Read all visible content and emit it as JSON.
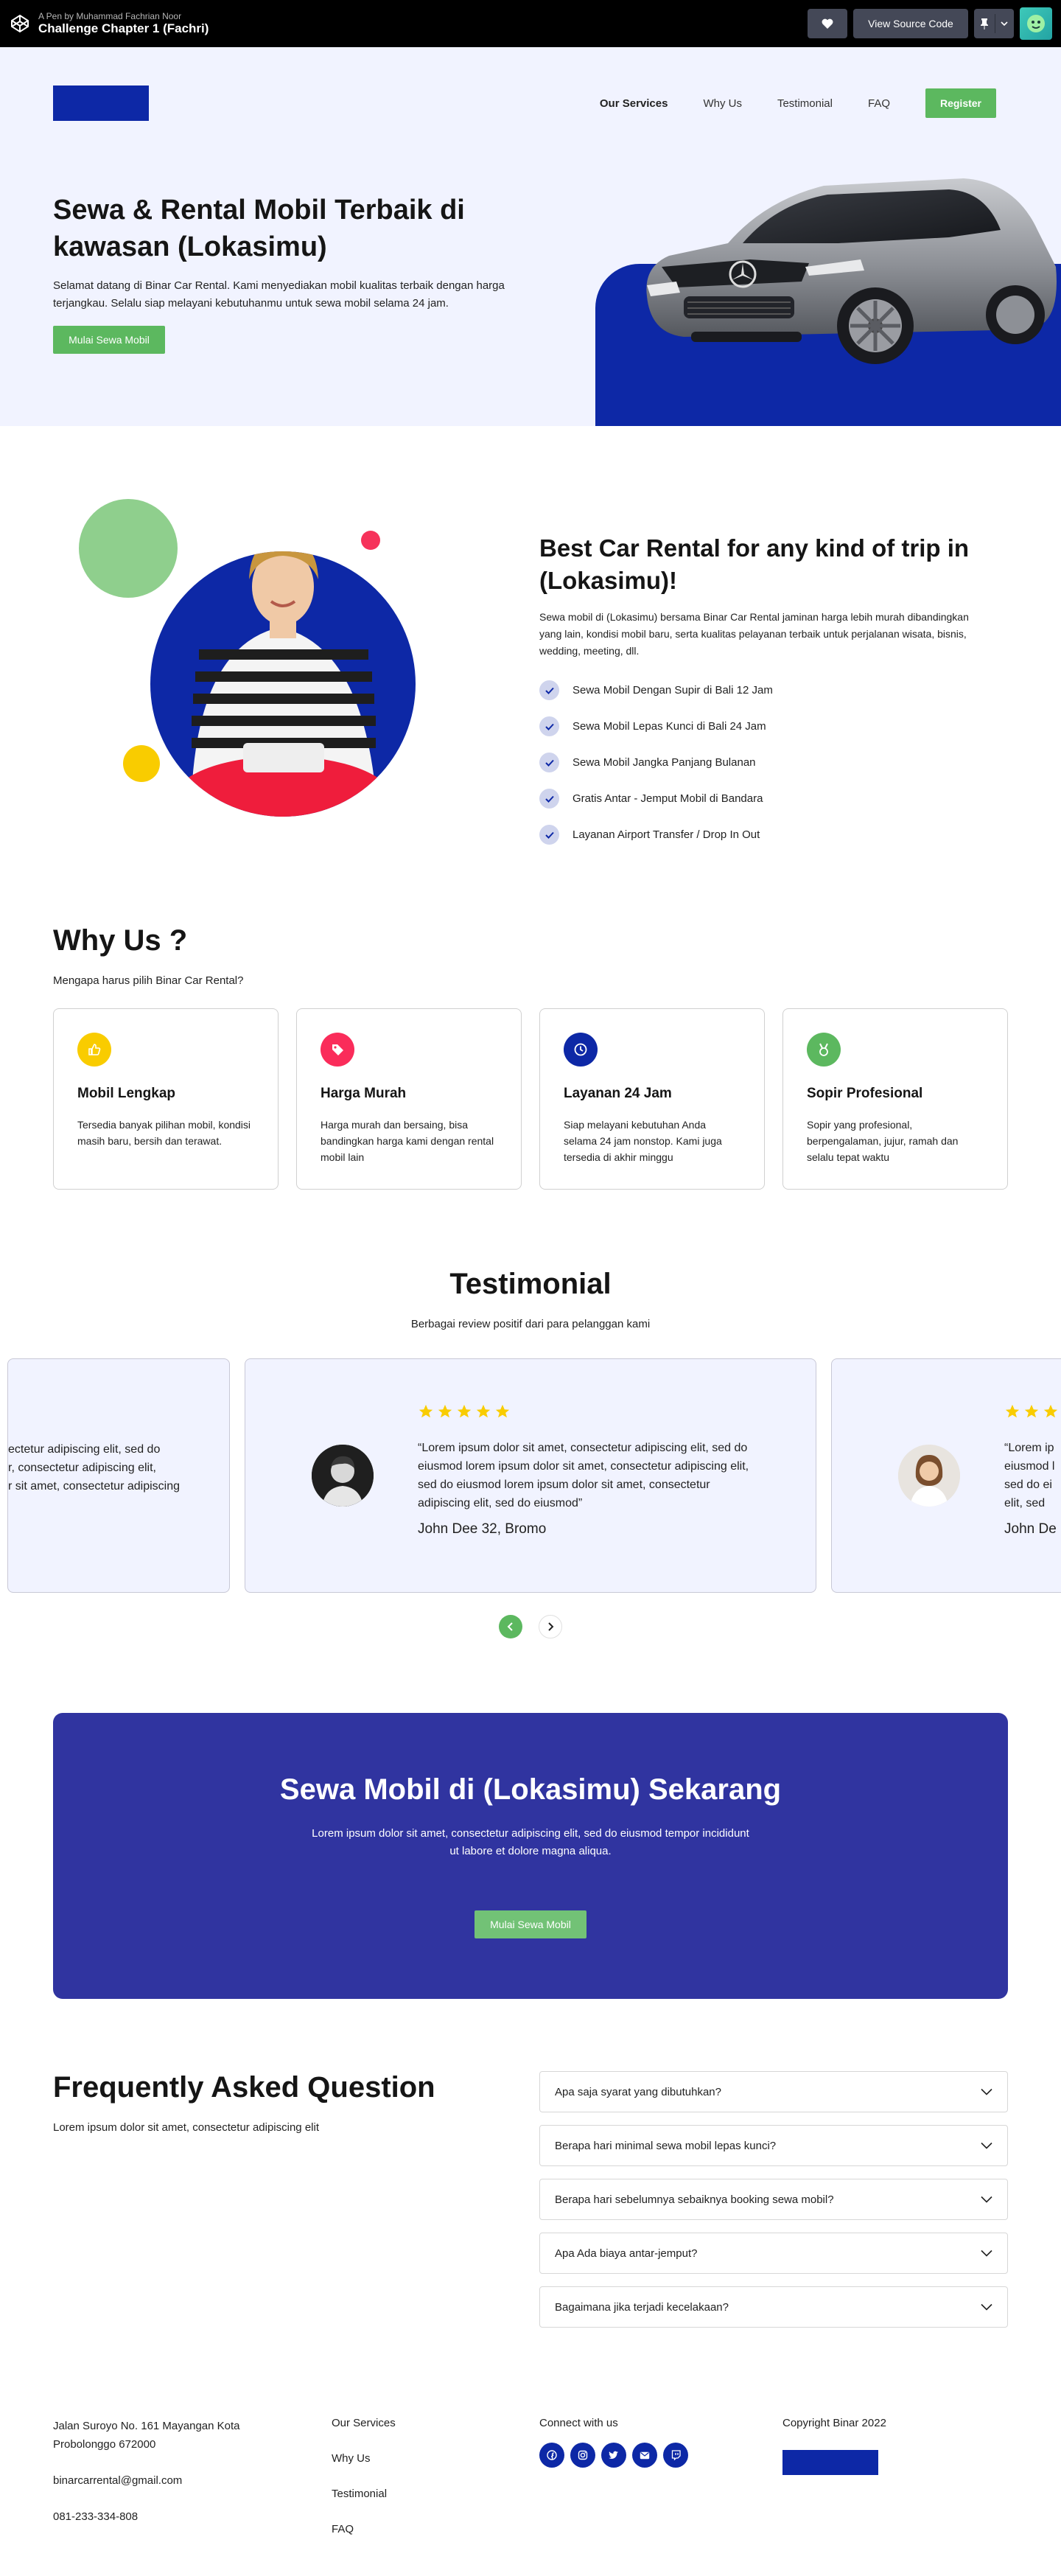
{
  "codepen": {
    "by": "A Pen by Muhammad Fachrian Noor",
    "title": "Challenge Chapter 1 (Fachri)",
    "view_source": "View Source Code"
  },
  "nav": {
    "items": [
      "Our Services",
      "Why Us",
      "Testimonial",
      "FAQ"
    ],
    "register": "Register"
  },
  "hero": {
    "title": "Sewa & Rental Mobil Terbaik di kawasan (Lokasimu)",
    "description": "Selamat datang di Binar Car Rental. Kami menyediakan mobil kualitas terbaik dengan harga terjangkau. Selalu siap melayani kebutuhanmu untuk sewa mobil selama 24 jam.",
    "cta": "Mulai Sewa Mobil"
  },
  "services": {
    "title": "Best Car Rental for any kind of trip in (Lokasimu)!",
    "description": "Sewa mobil di (Lokasimu) bersama Binar Car Rental jaminan harga lebih murah dibandingkan yang lain, kondisi mobil baru, serta kualitas pelayanan terbaik untuk perjalanan wisata, bisnis, wedding, meeting, dll.",
    "items": [
      "Sewa Mobil Dengan Supir di Bali 12 Jam",
      "Sewa Mobil Lepas Kunci di Bali 24 Jam",
      "Sewa Mobil Jangka Panjang Bulanan",
      "Gratis Antar - Jemput Mobil di Bandara",
      "Layanan Airport Transfer / Drop In Out"
    ]
  },
  "why": {
    "title": "Why Us ?",
    "subtitle": "Mengapa harus pilih Binar Car Rental?",
    "cards": [
      {
        "icon": "thumbs-up-icon",
        "color": "#f9cc00",
        "title": "Mobil Lengkap",
        "text": "Tersedia banyak pilihan mobil, kondisi masih baru, bersih dan terawat."
      },
      {
        "icon": "tag-icon",
        "color": "#fa2c5a",
        "title": "Harga Murah",
        "text": "Harga murah dan bersaing, bisa bandingkan harga kami dengan rental mobil lain"
      },
      {
        "icon": "clock-icon",
        "color": "#0d28a6",
        "title": "Layanan 24 Jam",
        "text": "Siap melayani kebutuhan Anda selama 24 jam nonstop. Kami juga tersedia di akhir minggu"
      },
      {
        "icon": "medal-icon",
        "color": "#5cb85f",
        "title": "Sopir Profesional",
        "text": "Sopir yang profesional, berpengalaman, jujur, ramah dan selalu tepat waktu"
      }
    ]
  },
  "testimonial": {
    "title": "Testimonial",
    "subtitle": "Berbagai review positif dari para pelanggan kami",
    "left_quote_lines": [
      "ectetur adipiscing elit, sed do",
      "r, consectetur adipiscing elit,",
      "r sit amet, consectetur adipiscing"
    ],
    "main": {
      "rating": 5,
      "quote": "“Lorem ipsum dolor sit amet, consectetur adipiscing elit, sed do eiusmod lorem ipsum dolor sit amet, consectetur adipiscing elit, sed do eiusmod lorem ipsum dolor sit amet, consectetur adipiscing elit, sed do eiusmod”",
      "author": "John Dee 32, Bromo"
    },
    "right_quote_lines": [
      "“Lorem ip",
      "eiusmod l",
      "sed do ei",
      "elit, sed"
    ],
    "right_author": "John De"
  },
  "cta": {
    "title": "Sewa Mobil di (Lokasimu) Sekarang",
    "text": "Lorem ipsum dolor sit amet, consectetur adipiscing elit, sed do eiusmod tempor incididunt ut labore et dolore magna aliqua.",
    "button": "Mulai Sewa Mobil"
  },
  "faq": {
    "title": "Frequently Asked Question",
    "subtitle": "Lorem ipsum dolor sit amet, consectetur adipiscing elit",
    "items": [
      "Apa saja syarat yang dibutuhkan?",
      "Berapa hari minimal sewa mobil lepas kunci?",
      "Berapa hari sebelumnya sebaiknya booking sewa mobil?",
      "Apa Ada biaya antar-jemput?",
      "Bagaimana jika terjadi kecelakaan?"
    ]
  },
  "footer": {
    "address": "Jalan Suroyo No. 161 Mayangan Kota Probolonggo 672000",
    "email": "binarcarrental@gmail.com",
    "phone": "081-233-334-808",
    "links": [
      "Our Services",
      "Why Us",
      "Testimonial",
      "FAQ"
    ],
    "connect": "Connect with us",
    "socials": [
      "facebook-icon",
      "instagram-icon",
      "twitter-icon",
      "mail-icon",
      "twitch-icon"
    ],
    "copyright": "Copyright Binar 2022"
  },
  "colors": {
    "primary": "#0d28a6",
    "green": "#5cb85f",
    "hero_bg": "#f1f3ff",
    "cta_bg": "#3034a0"
  }
}
